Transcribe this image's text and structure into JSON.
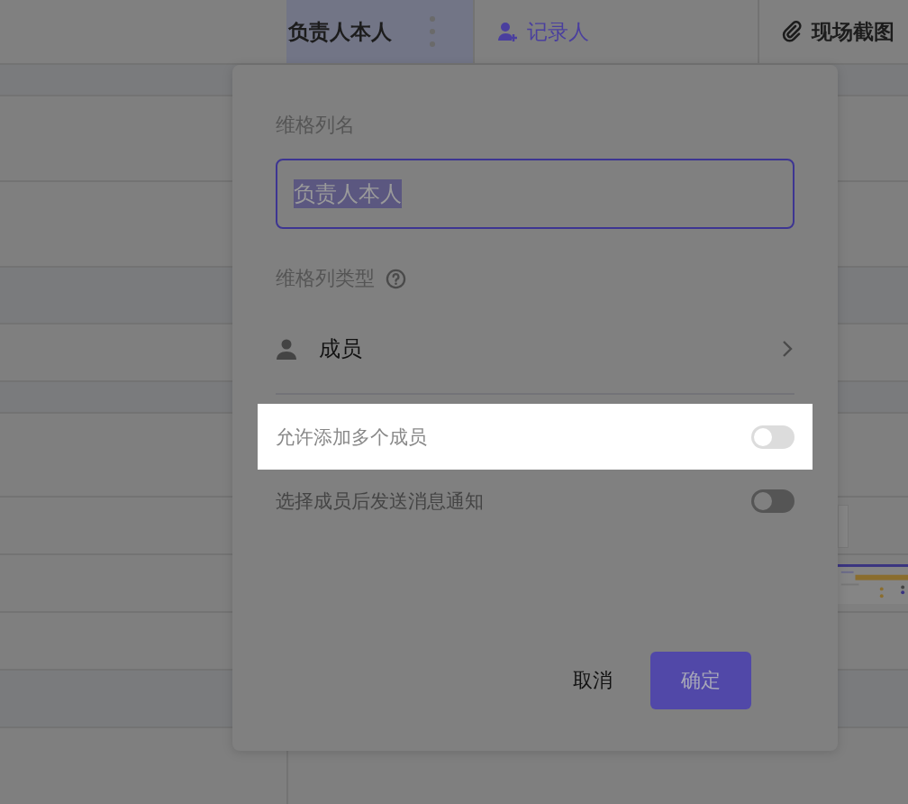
{
  "header": {
    "columns": [
      {
        "label": "负责人本人",
        "kind": "text",
        "selected": true
      },
      {
        "label": "记录人",
        "kind": "member",
        "selected": false
      },
      {
        "label": "现场截图",
        "kind": "attachment",
        "selected": false
      }
    ]
  },
  "dialog": {
    "name_label": "维格列名",
    "name_value": "负责人本人",
    "type_label": "维格列类型",
    "type_value": "成员",
    "options": [
      {
        "label": "允许添加多个成员",
        "on": false,
        "highlighted": true
      },
      {
        "label": "选择成员后发送消息通知",
        "on": false,
        "highlighted": false
      }
    ],
    "cancel": "取消",
    "confirm": "确定"
  }
}
